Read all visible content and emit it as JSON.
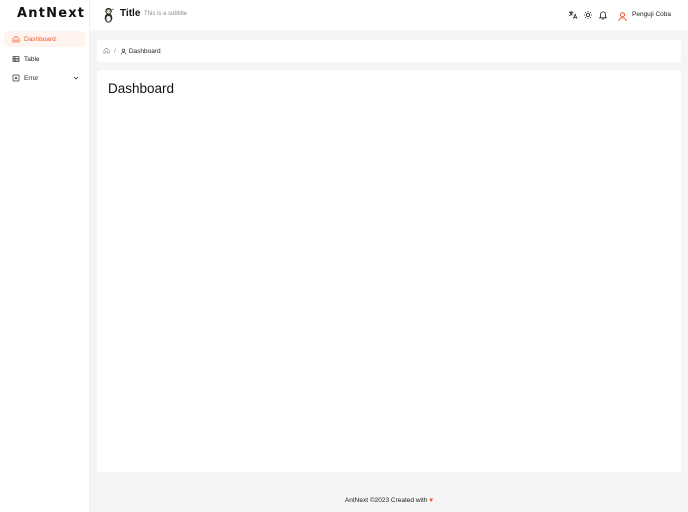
{
  "brand": "AntNext",
  "header": {
    "title": "Title",
    "subtitle": "This is a subtitle",
    "user_name": "Penguji Coba",
    "icons": [
      "translate-icon",
      "theme-sun-icon",
      "notification-bell-icon",
      "user-icon"
    ]
  },
  "sidebar": {
    "items": [
      {
        "label": "Dashboard",
        "icon": "home-icon",
        "active": true
      },
      {
        "label": "Table",
        "icon": "table-icon",
        "active": false
      },
      {
        "label": "Error",
        "icon": "error-icon",
        "active": false,
        "expandable": true
      }
    ]
  },
  "breadcrumb": {
    "items": [
      {
        "icon": "home-icon"
      },
      {
        "icon": "user-icon",
        "label": "Dashboard"
      }
    ],
    "separator": "/"
  },
  "main": {
    "page_title": "Dashboard"
  },
  "footer": {
    "text": "AntNext ©2023 Created with",
    "heart": "♥"
  },
  "colors": {
    "accent": "#f5542d",
    "active_bg": "#fff4ef",
    "background": "#f5f5f5"
  }
}
